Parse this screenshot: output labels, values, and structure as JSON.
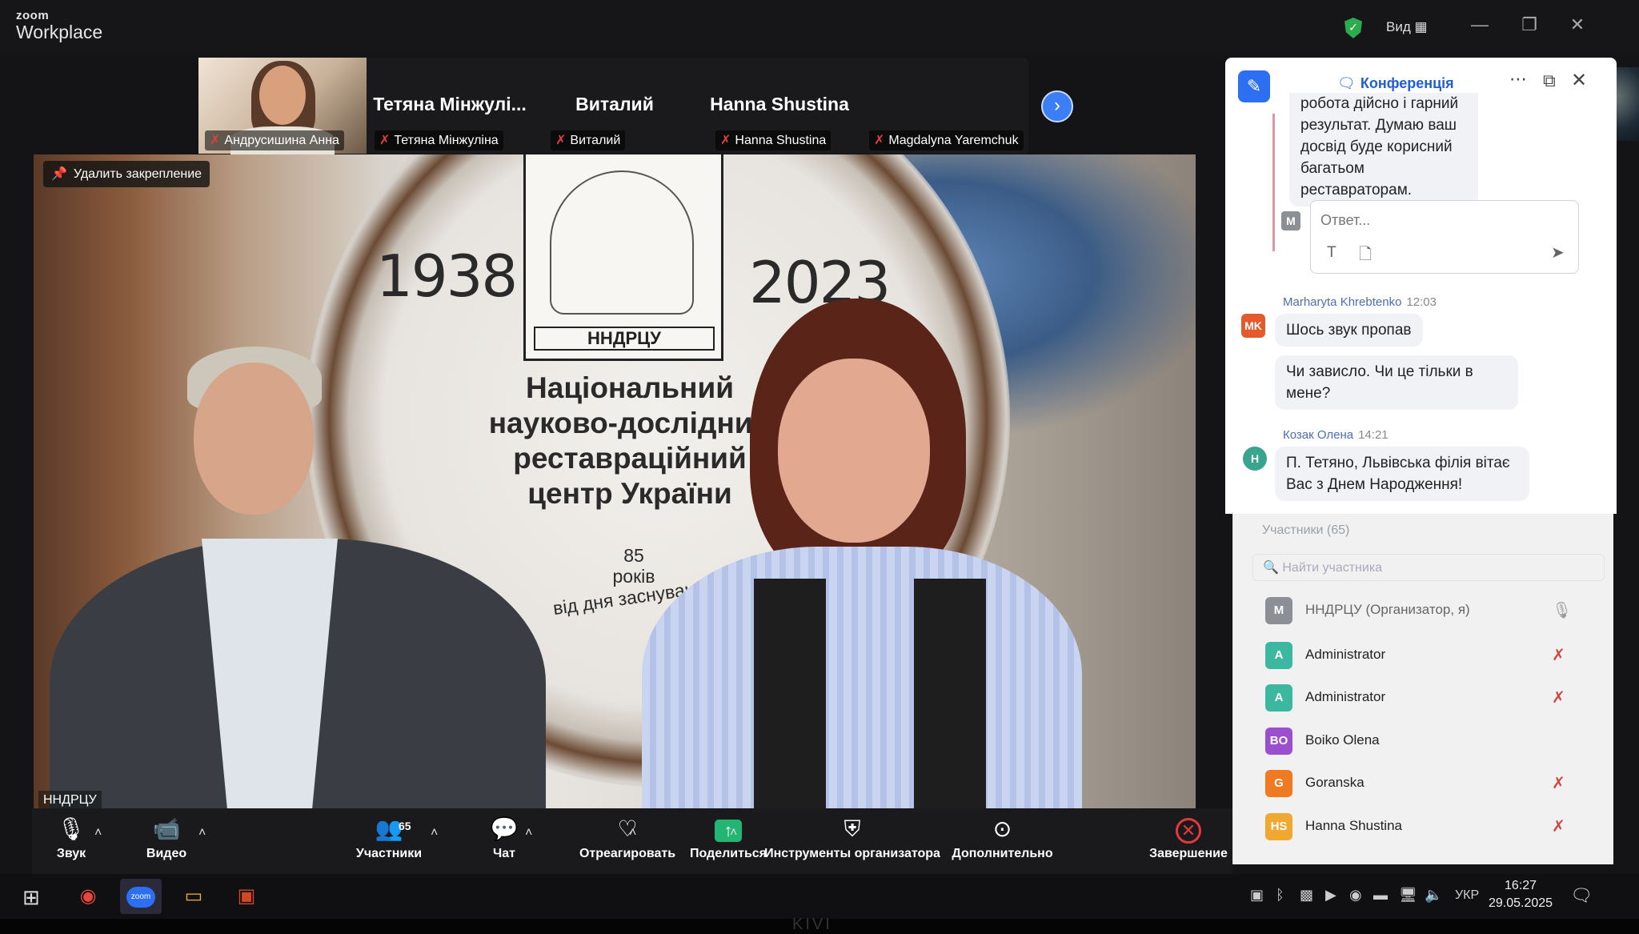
{
  "app": {
    "logo_top": "zoom",
    "logo_bottom": "Workplace",
    "view_label": "Вид"
  },
  "filmstrip": {
    "tiles": [
      {
        "label": "Андрусишина Анна"
      },
      {
        "name": "Тетяна Мінжулі...",
        "label": "Тетяна Мінжуліна"
      },
      {
        "name": "Виталий",
        "label": "Виталий"
      },
      {
        "name": "Hanna Shustina",
        "label": "Hanna Shustina"
      },
      {
        "label": "Magdalyna Yaremchuk"
      }
    ]
  },
  "main_video": {
    "unpin_label": "Удалить закрепление",
    "speaker_label": "НHДРЦУ",
    "backdrop": {
      "year_left": "1938",
      "year_right": "2023",
      "seal": "НHДРЦУ",
      "line1": "Національний",
      "line2": "науково-дослідний",
      "line3": "реставраційний",
      "line4": "центр України",
      "anniv_num": "85",
      "anniv_word": "років",
      "anniv_from": "від дня заснування"
    }
  },
  "chat": {
    "title": "Конференція",
    "thread_text_1": "робота дійсно і гарний",
    "thread_text_2": "результат. Думаю ваш",
    "thread_text_3": "досвід буде корисний",
    "thread_text_4": "багатьом реставраторам.",
    "reply_placeholder": "Ответ...",
    "reply_avatar": "M",
    "messages": [
      {
        "sender": "Marharyta Khrebtenko",
        "time": "12:03",
        "avatar": "MK",
        "text1": "Шось звук пропав",
        "text2a": "Чи зависло. Чи це тільки в",
        "text2b": "мене?"
      },
      {
        "sender": "Козак Олена",
        "time": "14:21",
        "avatar": "H",
        "text1a": "П. Тетяно, Львівська філія вітає",
        "text1b": "Вас з Днем Народження!"
      }
    ]
  },
  "participants": {
    "title": "Участники (65)",
    "search_placeholder": "Найти участника",
    "rows": [
      {
        "initials": "M",
        "name": "НHДРЦУ (Организатор, я)",
        "color": "#8c8f96"
      },
      {
        "initials": "A",
        "name": "Administrator",
        "color": "#3db8a0"
      },
      {
        "initials": "A",
        "name": "Administrator",
        "color": "#3db8a0"
      },
      {
        "initials": "BO",
        "name": "Boiko Olena",
        "color": "#9b4fcf"
      },
      {
        "initials": "G",
        "name": "Goranska",
        "color": "#ef7a22"
      },
      {
        "initials": "HS",
        "name": "Hanna Shustina",
        "color": "#f0a830"
      }
    ]
  },
  "controls": {
    "audio": "Звук",
    "video": "Видео",
    "participants": "Участники",
    "participants_count": "65",
    "chat": "Чат",
    "react": "Отреагировать",
    "share": "Поделиться",
    "host_tools": "Инструменты организатора",
    "more": "Дополнительно",
    "end": "Завершение"
  },
  "taskbar": {
    "lang": "УКР",
    "time": "16:27",
    "date": "29.05.2025"
  },
  "monitor_brand": "KIVI",
  "colors": {
    "zoom_blue": "#2d6ff2",
    "end_red": "#e3383c",
    "share_green": "#22b573"
  }
}
